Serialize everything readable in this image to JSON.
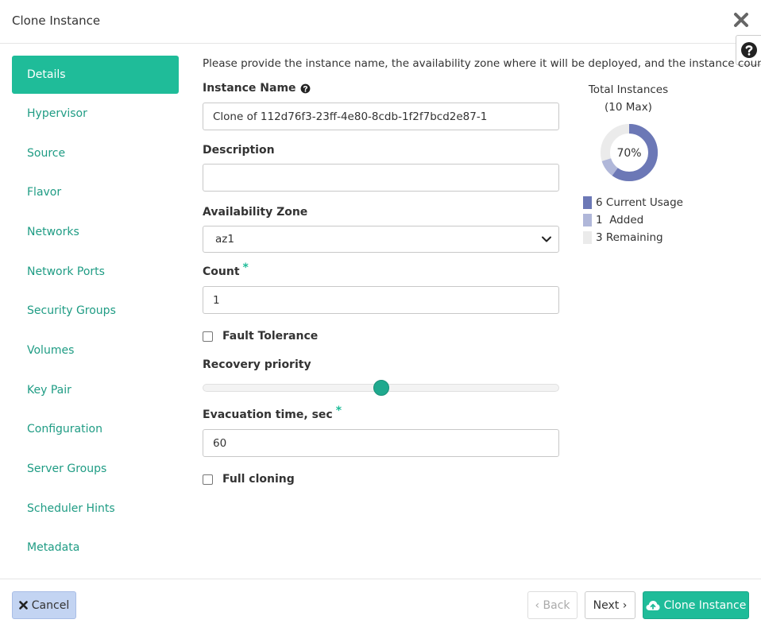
{
  "dialog": {
    "title": "Clone Instance",
    "close_icon": "close-icon",
    "help_icon": "question-circle-icon"
  },
  "sidebar": {
    "items": [
      {
        "label": "Details",
        "active": true
      },
      {
        "label": "Hypervisor"
      },
      {
        "label": "Source"
      },
      {
        "label": "Flavor"
      },
      {
        "label": "Networks"
      },
      {
        "label": "Network Ports"
      },
      {
        "label": "Security Groups"
      },
      {
        "label": "Volumes"
      },
      {
        "label": "Key Pair"
      },
      {
        "label": "Configuration"
      },
      {
        "label": "Server Groups"
      },
      {
        "label": "Scheduler Hints"
      },
      {
        "label": "Metadata"
      }
    ]
  },
  "form": {
    "intro": "Please provide the instance name, the availability zone where it will be deployed, and the instance count.",
    "instance_name_label": "Instance Name",
    "instance_name_value": "Clone of 112d76f3-23ff-4e80-8cdb-1f2f7bcd2e87-1",
    "description_label": "Description",
    "description_value": "",
    "availability_zone_label": "Availability Zone",
    "availability_zone_value": "az1",
    "count_label": "Count",
    "count_value": "1",
    "required_marker": "*",
    "fault_tolerance_label": "Fault Tolerance",
    "fault_tolerance_checked": false,
    "recovery_priority_label": "Recovery priority",
    "recovery_priority_level": 0.5,
    "evacuation_label": "Evacuation time, sec",
    "evacuation_value": "60",
    "full_cloning_label": "Full cloning",
    "full_cloning_checked": false
  },
  "quota": {
    "title": "Total Instances",
    "max": "(10 Max)",
    "percent": "70%",
    "current_usage": 6,
    "added": 1,
    "remaining": 3,
    "legend": [
      {
        "count": "6",
        "label": "Current Usage",
        "color": "#6c78b6"
      },
      {
        "count": "1",
        "label": "Added",
        "color": "#b0b7d9"
      },
      {
        "count": "3",
        "label": "Remaining",
        "color": "#ebebeb"
      }
    ]
  },
  "footer": {
    "cancel_label": "Cancel",
    "back_label": "‹ Back",
    "next_label": "Next ›",
    "clone_label": "Clone Instance"
  },
  "colors": {
    "accent": "#1fbc99",
    "link": "#1f9c84",
    "cancel_bg": "#c3d4f2"
  }
}
